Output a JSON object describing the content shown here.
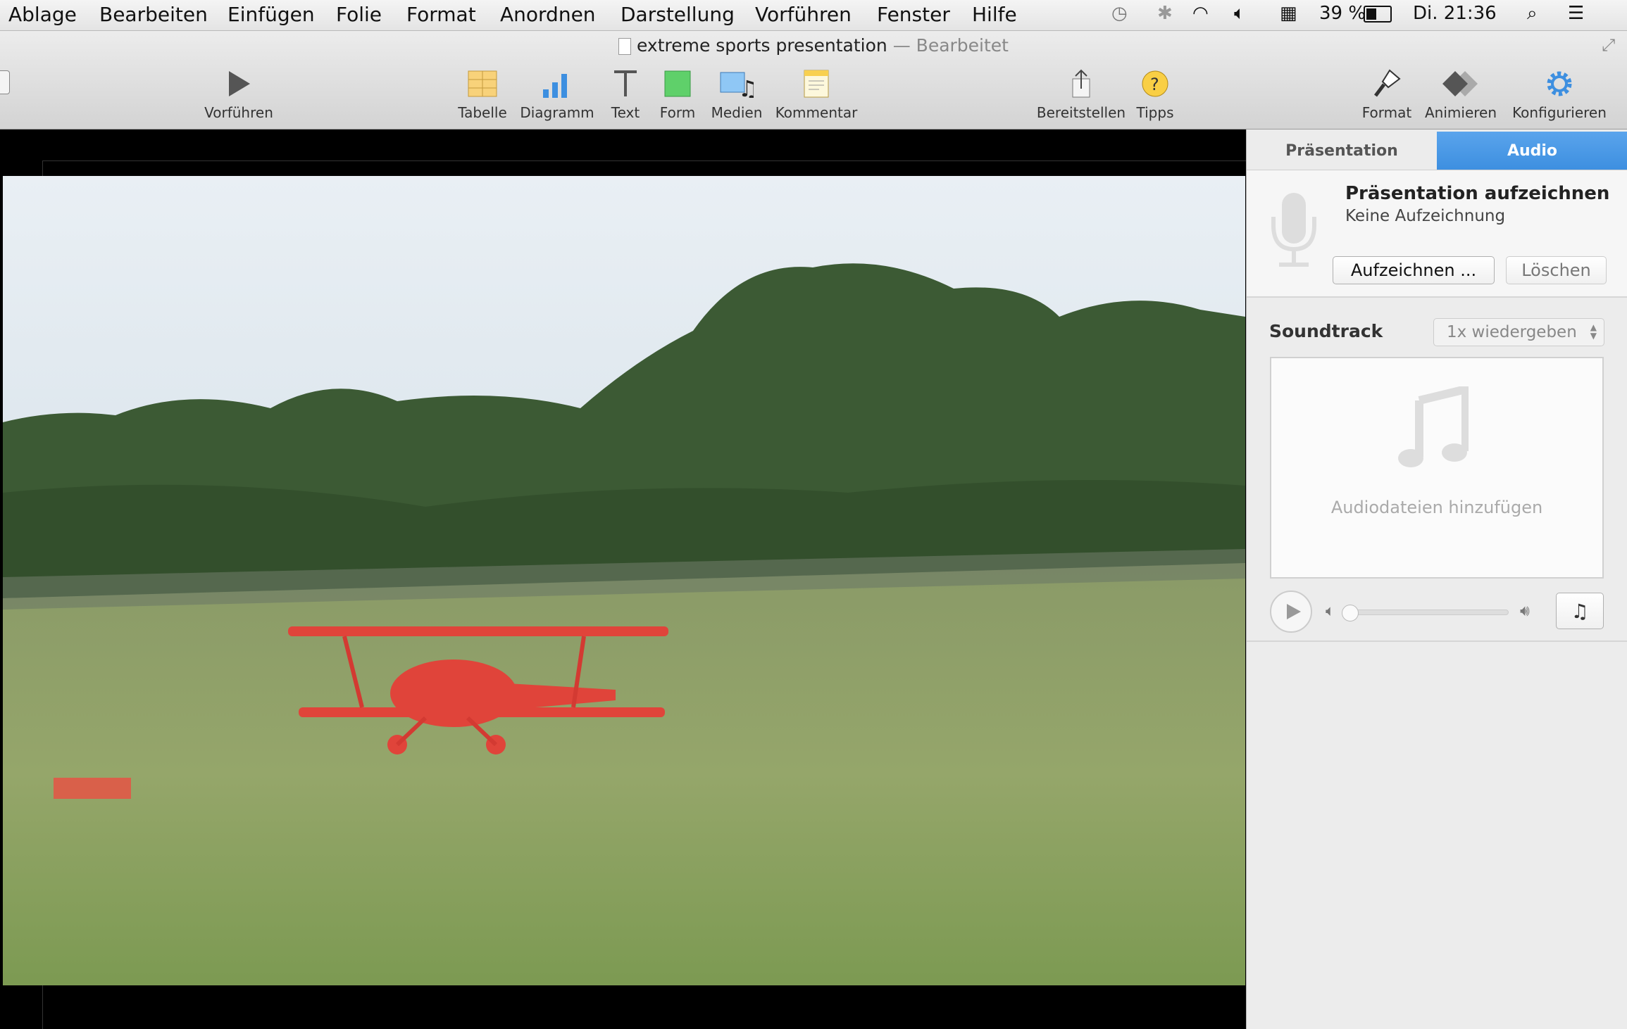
{
  "menubar": {
    "items": [
      "Ablage",
      "Bearbeiten",
      "Einfügen",
      "Folie",
      "Format",
      "Anordnen",
      "Darstellung",
      "Vorführen",
      "Fenster",
      "Hilfe"
    ],
    "battery": "39 %",
    "clock": "Di. 21:36"
  },
  "window": {
    "title": "extreme sports presentation",
    "separator": "—",
    "status": "Bearbeitet"
  },
  "toolbar": {
    "play": "Vorführen",
    "table": "Tabelle",
    "chart": "Diagramm",
    "text": "Text",
    "shape": "Form",
    "media": "Medien",
    "comment": "Kommentar",
    "share": "Bereitstellen",
    "tips": "Tipps",
    "format": "Format",
    "animate": "Animieren",
    "configure": "Konfigurieren"
  },
  "sidebar": {
    "tabs": [
      "Präsentation",
      "Audio"
    ],
    "active_tab": "Audio",
    "accent": "#3d8fe0",
    "record": {
      "title": "Präsentation aufzeichnen",
      "status": "Keine Aufzeichnung",
      "record_button": "Aufzeichnen ...",
      "delete_button": "Löschen"
    },
    "soundtrack": {
      "label": "Soundtrack",
      "mode": "1x wiedergeben",
      "drop_hint": "Audiodateien hinzufügen",
      "volume": 0
    }
  }
}
